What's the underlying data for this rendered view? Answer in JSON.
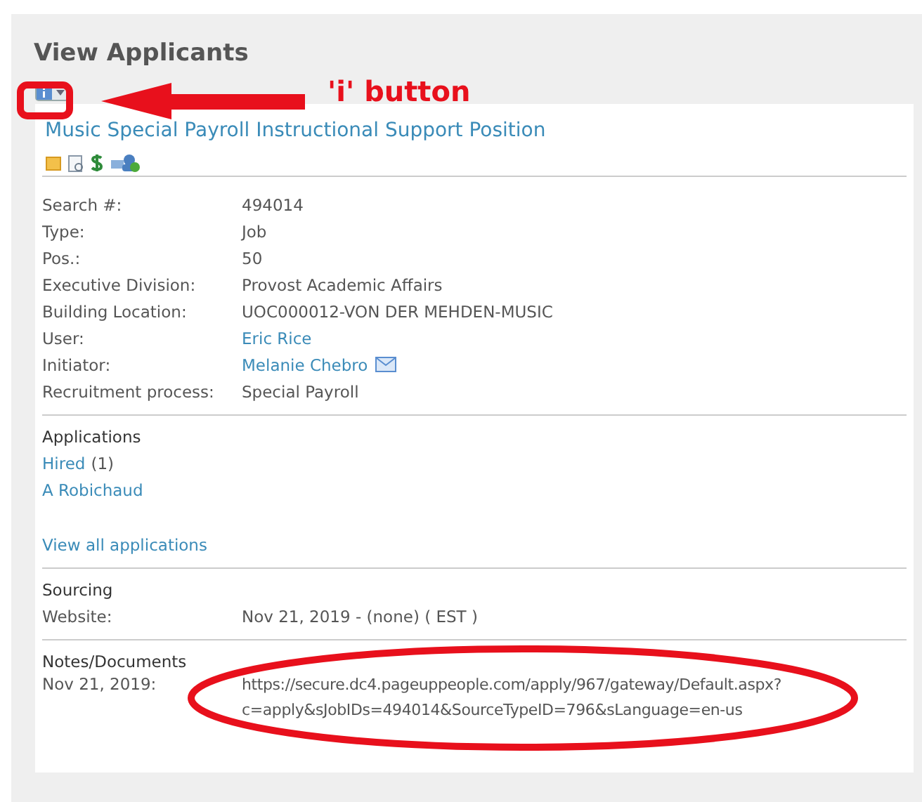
{
  "page_title": "View Applicants",
  "annotation": {
    "label": "'i' button"
  },
  "job_title": "Music Special Payroll Instructional Support Position",
  "details": [
    {
      "label": "Search #:",
      "value": "494014",
      "kind": "text"
    },
    {
      "label": "Type:",
      "value": "Job",
      "kind": "text"
    },
    {
      "label": "Pos.:",
      "value": "50",
      "kind": "text"
    },
    {
      "label": "Executive Division:",
      "value": "Provost Academic Affairs",
      "kind": "text"
    },
    {
      "label": "Building Location:",
      "value": "UOC000012-VON DER MEHDEN-MUSIC",
      "kind": "text"
    },
    {
      "label": "User:",
      "value": "Eric Rice",
      "kind": "link"
    },
    {
      "label": "Initiator:",
      "value": "Melanie Chebro",
      "kind": "email"
    },
    {
      "label": "Recruitment process:",
      "value": "Special Payroll",
      "kind": "text"
    }
  ],
  "applications": {
    "heading": "Applications",
    "status": "Hired",
    "count": "(1)",
    "applicant": "A Robichaud",
    "view_all": "View all applications"
  },
  "sourcing": {
    "heading": "Sourcing",
    "label": "Website:",
    "value": "Nov 21, 2019 - (none) ( EST )"
  },
  "notes": {
    "heading": "Notes/Documents",
    "label": "Nov 21, 2019:",
    "lines": [
      "https://secure.dc4.pageuppeople.com/apply/967/gateway/Default.aspx?",
      "c=apply&sJobIDs=494014&SourceTypeID=796&sLanguage=en-us"
    ]
  }
}
